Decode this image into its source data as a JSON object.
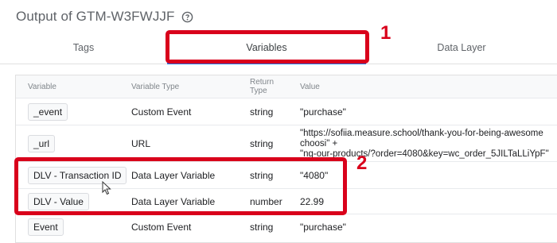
{
  "header": {
    "title": "Output of GTM-W3FWJJF",
    "help_icon": "help-circle-icon"
  },
  "tabs": [
    {
      "label": "Tags"
    },
    {
      "label": "Variables",
      "active": true
    },
    {
      "label": "Data Layer"
    }
  ],
  "table": {
    "columns": {
      "variable": "Variable",
      "type": "Variable Type",
      "return_line1": "Return",
      "return_line2": "Type",
      "value": "Value"
    },
    "rows": [
      {
        "variable": "_event",
        "type": "Custom Event",
        "return_type": "string",
        "value": "\"purchase\""
      },
      {
        "variable": "_url",
        "type": "URL",
        "return_type": "string",
        "value_line1": "\"https://sofiia.measure.school/thank-you-for-being-awesome",
        "value_line2": "choosi\" +",
        "value_line3": "\"ng-our-products/?order=4080&key=wc_order_5JILTaLLiYpF\""
      },
      {
        "variable": "DLV - Transaction ID",
        "type": "Data Layer Variable",
        "return_type": "string",
        "value": "\"4080\""
      },
      {
        "variable": "DLV - Value",
        "type": "Data Layer Variable",
        "return_type": "number",
        "value": "22.99"
      },
      {
        "variable": "Event",
        "type": "Custom Event",
        "return_type": "string",
        "value": "\"purchase\""
      }
    ]
  },
  "annotations": {
    "label1": "1",
    "label2": "2",
    "color": "#d9001b"
  },
  "colors": {
    "accent": "#1a73e8",
    "highlight": "#d9001b"
  }
}
